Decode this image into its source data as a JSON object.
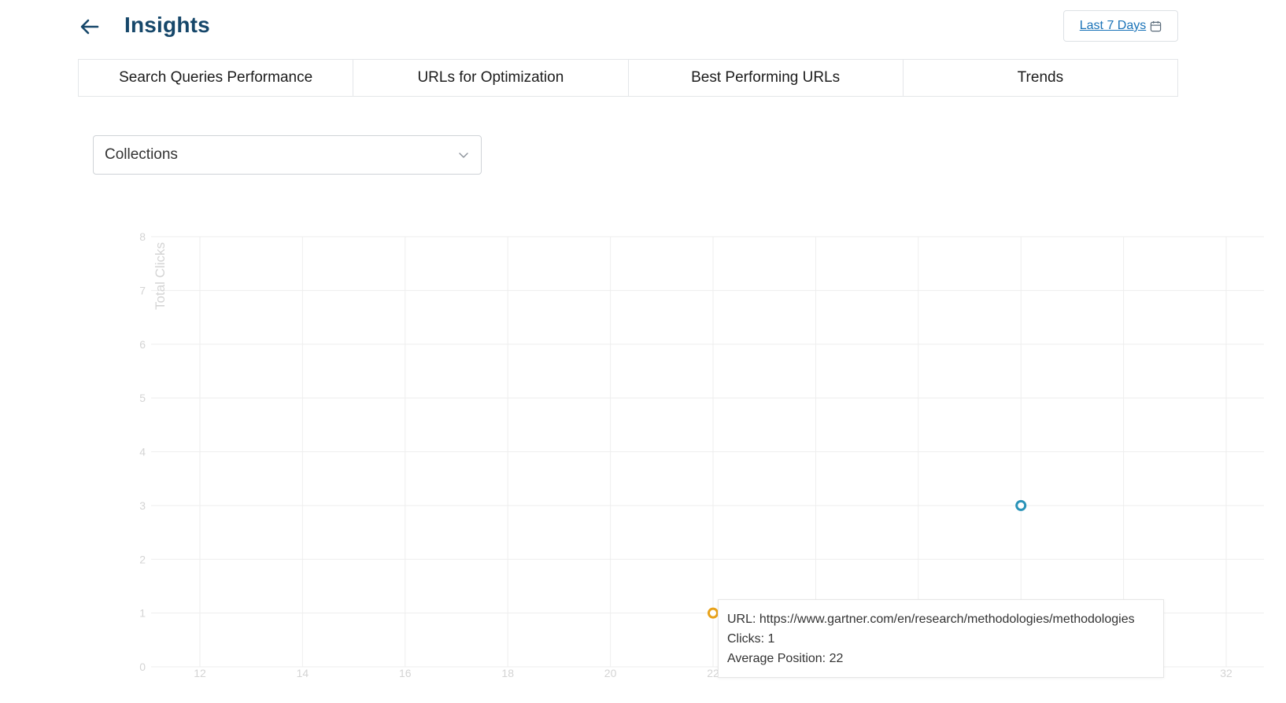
{
  "header": {
    "title": "Insights",
    "date_range_label": "Last 7 Days"
  },
  "tabs": [
    {
      "label": "Search Queries Performance"
    },
    {
      "label": "URLs for Optimization"
    },
    {
      "label": "Best Performing URLs"
    },
    {
      "label": "Trends"
    }
  ],
  "filter": {
    "selected": "Collections"
  },
  "tooltip": {
    "url_line": "URL: https://www.gartner.com/en/research/methodologies/methodologies",
    "clicks_line": "Clicks: 1",
    "position_line": "Average Position: 22"
  },
  "chart_data": {
    "type": "scatter",
    "title": "",
    "xlabel": "",
    "ylabel": "Total Clicks",
    "x_ticks": [
      12,
      14,
      16,
      18,
      20,
      22,
      32
    ],
    "y_ticks": [
      0,
      1,
      2,
      3,
      4,
      5,
      6,
      7,
      8
    ],
    "xlim": [
      11,
      33
    ],
    "ylim": [
      0,
      8
    ],
    "grid": true,
    "points": [
      {
        "x": 22,
        "y": 1,
        "color": "#e8a21a"
      },
      {
        "x": 28,
        "y": 3,
        "color": "#2a93b8"
      }
    ]
  },
  "colors": {
    "title": "#16476a",
    "link": "#1a73b8",
    "grid": "#eeeeee",
    "axis_text": "#d4d4d4"
  }
}
